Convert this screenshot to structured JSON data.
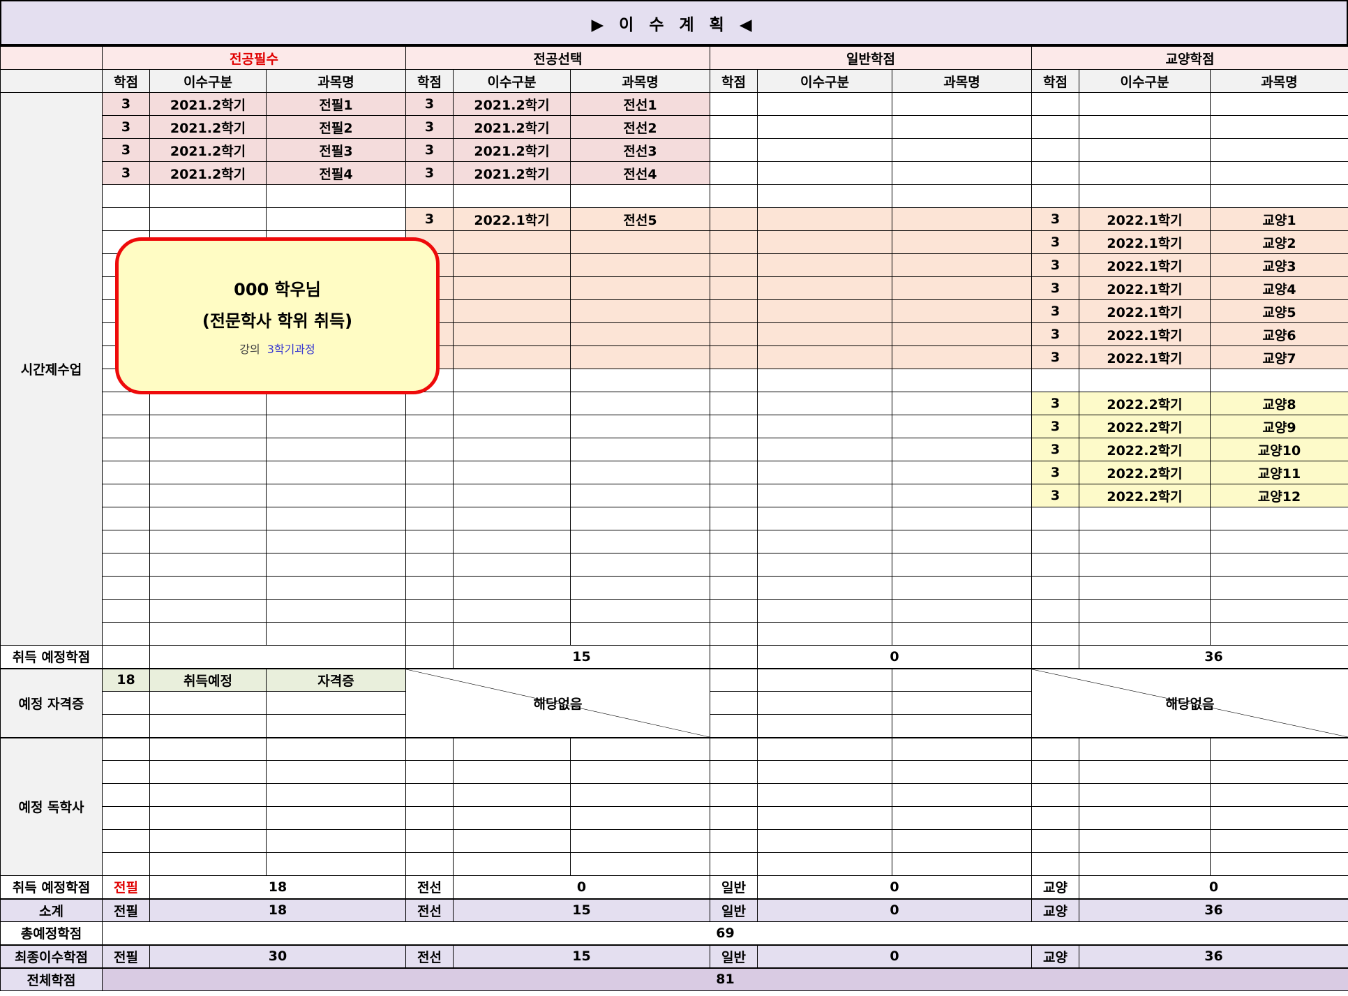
{
  "title": "▶ 이 수 계 획 ◀",
  "groups": [
    "전공필수",
    "전공선택",
    "일반학점",
    "교양학점"
  ],
  "sub_headers": [
    "학점",
    "이수구분",
    "과목명"
  ],
  "row_labels": {
    "part_time": "시간제수업",
    "expected_credit": "취득 예정학점",
    "certificate": "예정 자격증",
    "dokhaksa": "예정 독학사",
    "subtotal": "소계",
    "total_expected": "총예정학점",
    "final_credit": "최종이수학점",
    "total_credit": "전체학점"
  },
  "abbr": [
    "전필",
    "전선",
    "일반",
    "교양"
  ],
  "rows": [
    [
      [
        "3",
        "2021.2학기",
        "전필1"
      ],
      [
        "3",
        "2021.2학기",
        "전선1"
      ],
      [
        "",
        "",
        ""
      ],
      [
        "",
        "",
        ""
      ]
    ],
    [
      [
        "3",
        "2021.2학기",
        "전필2"
      ],
      [
        "3",
        "2021.2학기",
        "전선2"
      ],
      [
        "",
        "",
        ""
      ],
      [
        "",
        "",
        ""
      ]
    ],
    [
      [
        "3",
        "2021.2학기",
        "전필3"
      ],
      [
        "3",
        "2021.2학기",
        "전선3"
      ],
      [
        "",
        "",
        ""
      ],
      [
        "",
        "",
        ""
      ]
    ],
    [
      [
        "3",
        "2021.2학기",
        "전필4"
      ],
      [
        "3",
        "2021.2학기",
        "전선4"
      ],
      [
        "",
        "",
        ""
      ],
      [
        "",
        "",
        ""
      ]
    ],
    [
      [
        "",
        "",
        ""
      ],
      [
        "",
        "",
        ""
      ],
      [
        "",
        "",
        ""
      ],
      [
        "",
        "",
        ""
      ]
    ],
    [
      [
        "",
        "",
        ""
      ],
      [
        "3",
        "2022.1학기",
        "전선5"
      ],
      [
        "",
        "",
        ""
      ],
      [
        "3",
        "2022.1학기",
        "교양1"
      ]
    ],
    [
      [
        "",
        "",
        ""
      ],
      [
        "",
        "",
        ""
      ],
      [
        "",
        "",
        ""
      ],
      [
        "3",
        "2022.1학기",
        "교양2"
      ]
    ],
    [
      [
        "",
        "",
        ""
      ],
      [
        "",
        "",
        ""
      ],
      [
        "",
        "",
        ""
      ],
      [
        "3",
        "2022.1학기",
        "교양3"
      ]
    ],
    [
      [
        "",
        "",
        ""
      ],
      [
        "",
        "",
        ""
      ],
      [
        "",
        "",
        ""
      ],
      [
        "3",
        "2022.1학기",
        "교양4"
      ]
    ],
    [
      [
        "",
        "",
        ""
      ],
      [
        "",
        "",
        ""
      ],
      [
        "",
        "",
        ""
      ],
      [
        "3",
        "2022.1학기",
        "교양5"
      ]
    ],
    [
      [
        "",
        "",
        ""
      ],
      [
        "",
        "",
        ""
      ],
      [
        "",
        "",
        ""
      ],
      [
        "3",
        "2022.1학기",
        "교양6"
      ]
    ],
    [
      [
        "",
        "",
        ""
      ],
      [
        "",
        "",
        ""
      ],
      [
        "",
        "",
        ""
      ],
      [
        "3",
        "2022.1학기",
        "교양7"
      ]
    ],
    [
      [
        "",
        "",
        ""
      ],
      [
        "",
        "",
        ""
      ],
      [
        "",
        "",
        ""
      ],
      [
        "",
        "",
        ""
      ]
    ],
    [
      [
        "",
        "",
        ""
      ],
      [
        "",
        "",
        ""
      ],
      [
        "",
        "",
        ""
      ],
      [
        "3",
        "2022.2학기",
        "교양8"
      ]
    ],
    [
      [
        "",
        "",
        ""
      ],
      [
        "",
        "",
        ""
      ],
      [
        "",
        "",
        ""
      ],
      [
        "3",
        "2022.2학기",
        "교양9"
      ]
    ],
    [
      [
        "",
        "",
        ""
      ],
      [
        "",
        "",
        ""
      ],
      [
        "",
        "",
        ""
      ],
      [
        "3",
        "2022.2학기",
        "교양10"
      ]
    ],
    [
      [
        "",
        "",
        ""
      ],
      [
        "",
        "",
        ""
      ],
      [
        "",
        "",
        ""
      ],
      [
        "3",
        "2022.2학기",
        "교양11"
      ]
    ],
    [
      [
        "",
        "",
        ""
      ],
      [
        "",
        "",
        ""
      ],
      [
        "",
        "",
        ""
      ],
      [
        "3",
        "2022.2학기",
        "교양12"
      ]
    ],
    [
      [
        "",
        "",
        ""
      ],
      [
        "",
        "",
        ""
      ],
      [
        "",
        "",
        ""
      ],
      [
        "",
        "",
        ""
      ]
    ],
    [
      [
        "",
        "",
        ""
      ],
      [
        "",
        "",
        ""
      ],
      [
        "",
        "",
        ""
      ],
      [
        "",
        "",
        ""
      ]
    ],
    [
      [
        "",
        "",
        ""
      ],
      [
        "",
        "",
        ""
      ],
      [
        "",
        "",
        ""
      ],
      [
        "",
        "",
        ""
      ]
    ],
    [
      [
        "",
        "",
        ""
      ],
      [
        "",
        "",
        ""
      ],
      [
        "",
        "",
        ""
      ],
      [
        "",
        "",
        ""
      ]
    ],
    [
      [
        "",
        "",
        ""
      ],
      [
        "",
        "",
        ""
      ],
      [
        "",
        "",
        ""
      ],
      [
        "",
        "",
        ""
      ]
    ],
    [
      [
        "",
        "",
        ""
      ],
      [
        "",
        "",
        ""
      ],
      [
        "",
        "",
        ""
      ],
      [
        "",
        "",
        ""
      ]
    ]
  ],
  "part_time_totals": [
    "",
    "15",
    "0",
    "36"
  ],
  "certificate": {
    "credit": "18",
    "status_header": "취득예정",
    "name_header": "자격증",
    "not_applicable": "해당없음"
  },
  "dokhaksa_totals": [
    "18",
    "0",
    "0",
    "0"
  ],
  "subtotal": [
    "18",
    "15",
    "0",
    "36"
  ],
  "total_expected": "69",
  "final_credit": [
    "30",
    "15",
    "0",
    "36"
  ],
  "total_credit": "81",
  "note": {
    "name": "000 학우님",
    "degree": "(전문학사 학위 취득)",
    "lecture_label": "강의",
    "lecture_value": "3학기과정"
  }
}
